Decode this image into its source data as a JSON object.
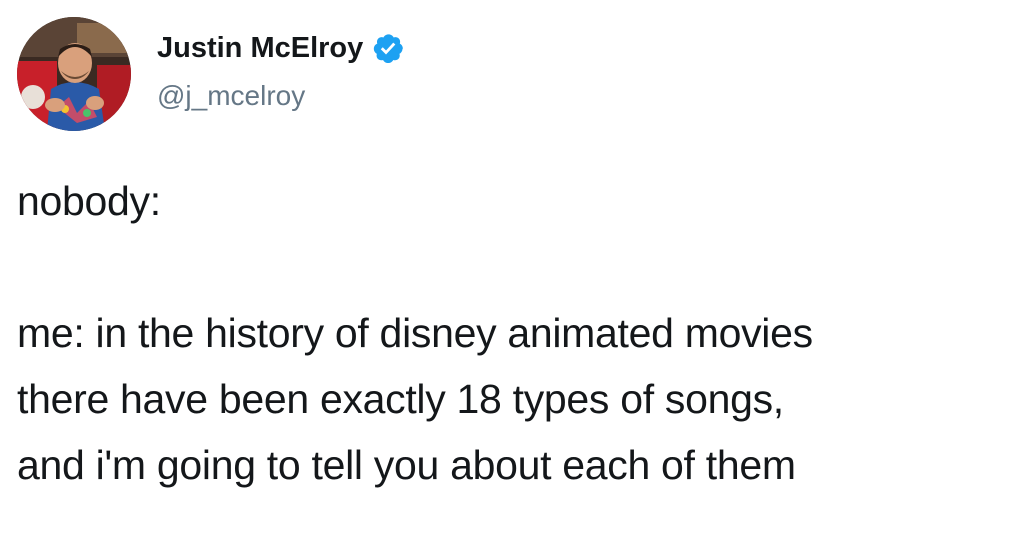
{
  "author": {
    "name": "Justin McElroy",
    "handle": "@j_mcelroy",
    "verified": true,
    "verified_icon": "verified-badge-icon",
    "verified_color": "#1da1f2"
  },
  "tweet": {
    "lines": [
      "nobody:",
      "me: in the history of disney animated movies",
      "there have been exactly 18 types of songs,",
      "and i'm going to tell you about each of them"
    ]
  },
  "colors": {
    "text": "#14171a",
    "handle": "#657786",
    "background": "#ffffff"
  }
}
